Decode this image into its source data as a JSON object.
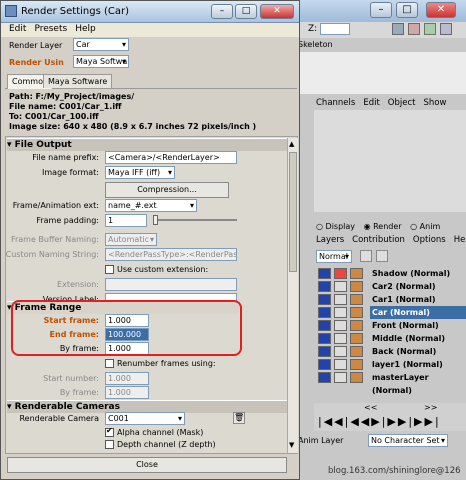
{
  "dialog": {
    "title": "Render Settings (Car)",
    "menu": [
      "Edit",
      "Presets",
      "Help"
    ],
    "render_layer_label": "Render Layer",
    "render_layer_value": "Car",
    "render_using_label": "Render Usin",
    "render_using_value": "Maya Software",
    "tabs": [
      "Common",
      "Maya Software"
    ],
    "info": {
      "path": "Path: F:/My_Project/images/",
      "file_name": "File name:  C001/Car_1.iff",
      "to": "To:           C001/Car_100.iff",
      "image_size": "Image size: 640 x 480 (8.9 x 6.7 inches 72 pixels/inch )"
    },
    "file_output": {
      "header": "File Output",
      "prefix_label": "File name prefix:",
      "prefix_value": "<Camera>/<RenderLayer>",
      "format_label": "Image format:",
      "format_value": "Maya IFF (iff)",
      "compression_label": "Compression...",
      "ext_label": "Frame/Animation ext:",
      "ext_value": "name_#.ext",
      "padding_label": "Frame padding:",
      "padding_value": "1",
      "buffer_label": "Frame Buffer Naming:",
      "buffer_value": "Automatic",
      "custom_label": "Custom Naming String:",
      "custom_value": "<RenderPassType>:<RenderPass>.<Car",
      "use_custom_ext": "Use custom extension:",
      "extension_label": "Extension:",
      "version_label": "Version Label:"
    },
    "frame_range": {
      "header": "Frame Range",
      "start_label": "Start frame:",
      "start_value": "1.000",
      "end_label": "End frame:",
      "end_value": "100.000",
      "by_label": "By frame:",
      "by_value": "1.000",
      "renumber_label": "Renumber frames using:",
      "start_number_label": "Start number:",
      "start_number_value": "1.000",
      "by_frame2_label": "By frame:",
      "by_frame2_value": "1.000"
    },
    "renderable_cameras": {
      "header": "Renderable Cameras",
      "camera_label": "Renderable Camera",
      "camera_value": "C001",
      "alpha_label": "Alpha channel (Mask)",
      "depth_label": "Depth channel (Z depth)"
    },
    "close_label": "Close"
  },
  "maya": {
    "z_label": "Z:",
    "skeleton_tab": "Skeleton",
    "channel_menu": [
      "Channels",
      "Edit",
      "Object",
      "Show"
    ],
    "radio_options": [
      "Display",
      "Render",
      "Anim"
    ],
    "layer_menu": [
      "Layers",
      "Contribution",
      "Options",
      "Help"
    ],
    "blend_mode": "Normal",
    "layers": [
      "Shadow (Normal)",
      "Car2 (Normal)",
      "Car1 (Normal)",
      "Car (Normal)",
      "Front (Normal)",
      "Middle (Normal)",
      "Back (Normal)",
      "layer1 (Normal)",
      "masterLayer (Normal)"
    ],
    "selected_layer": "Car (Normal)",
    "anim_layer": "Anim Layer",
    "character_set": "No Character Set",
    "watermark": "blog.163.com/shininglore@126"
  },
  "colors": {
    "selection": "#3a6ea5",
    "highlight_box": "#e02020",
    "orange_label": "#c05000"
  }
}
